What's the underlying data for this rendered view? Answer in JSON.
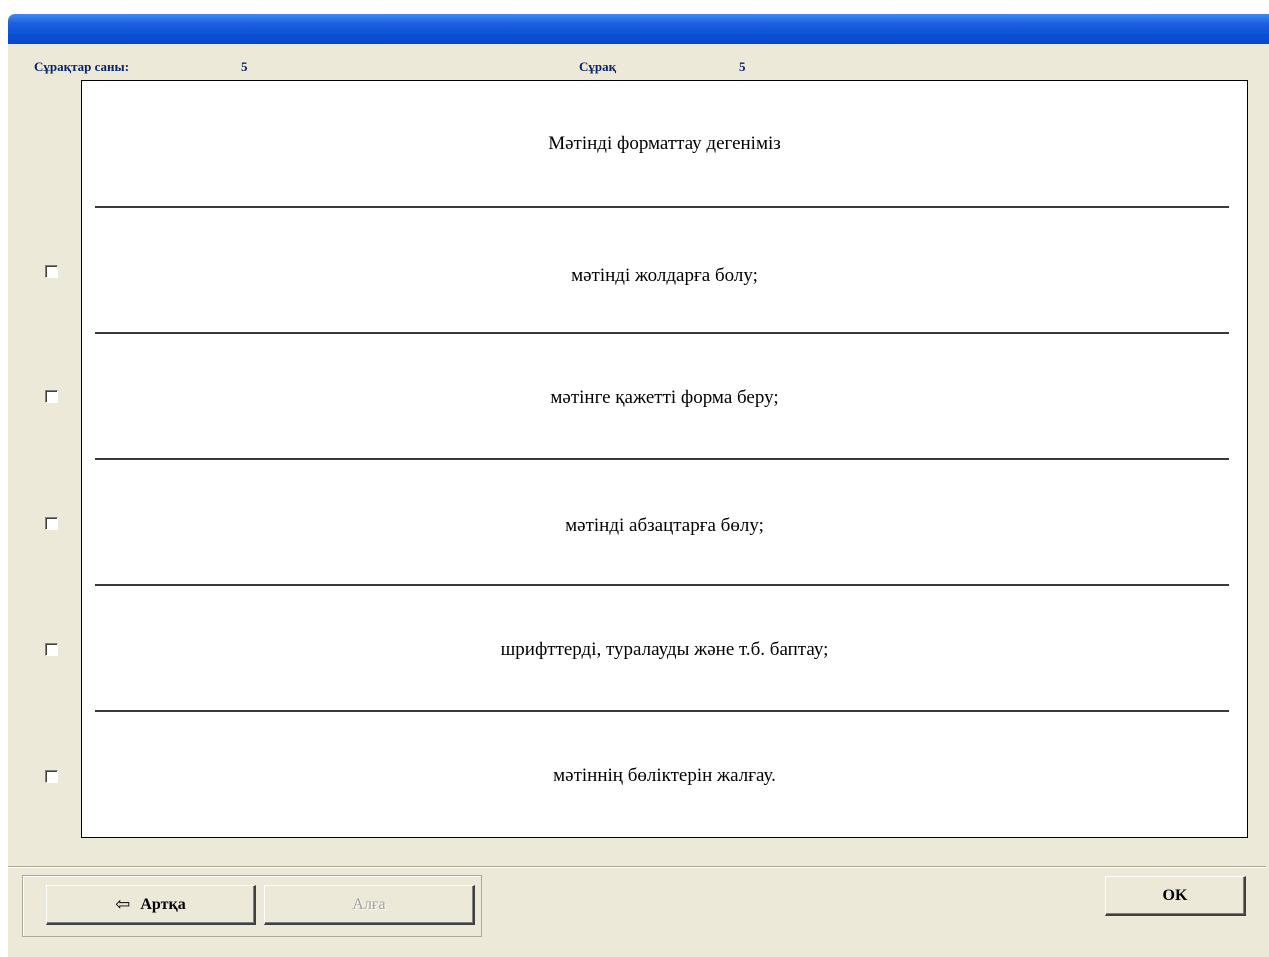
{
  "header": {
    "question_count_label": "Сұрақтар саны:",
    "question_count_value": "5",
    "question_label": "Сұрақ",
    "question_value": "5"
  },
  "question": {
    "text": "Мәтінді форматтау дегеніміз"
  },
  "answers": [
    {
      "text": "мәтінді жолдарға болу;",
      "checked": false
    },
    {
      "text": "мәтінге қажетті форма беру;",
      "checked": false
    },
    {
      "text": "мәтінді абзацтарға бөлу;",
      "checked": false
    },
    {
      "text": "шрифттерді, туралауды және т.б. баптау;",
      "checked": false
    },
    {
      "text": "мәтіннің бөліктерін жалғау.",
      "checked": false
    }
  ],
  "buttons": {
    "back_label": "Артқа",
    "forward_label": "Алға",
    "ok_label": "OK"
  }
}
